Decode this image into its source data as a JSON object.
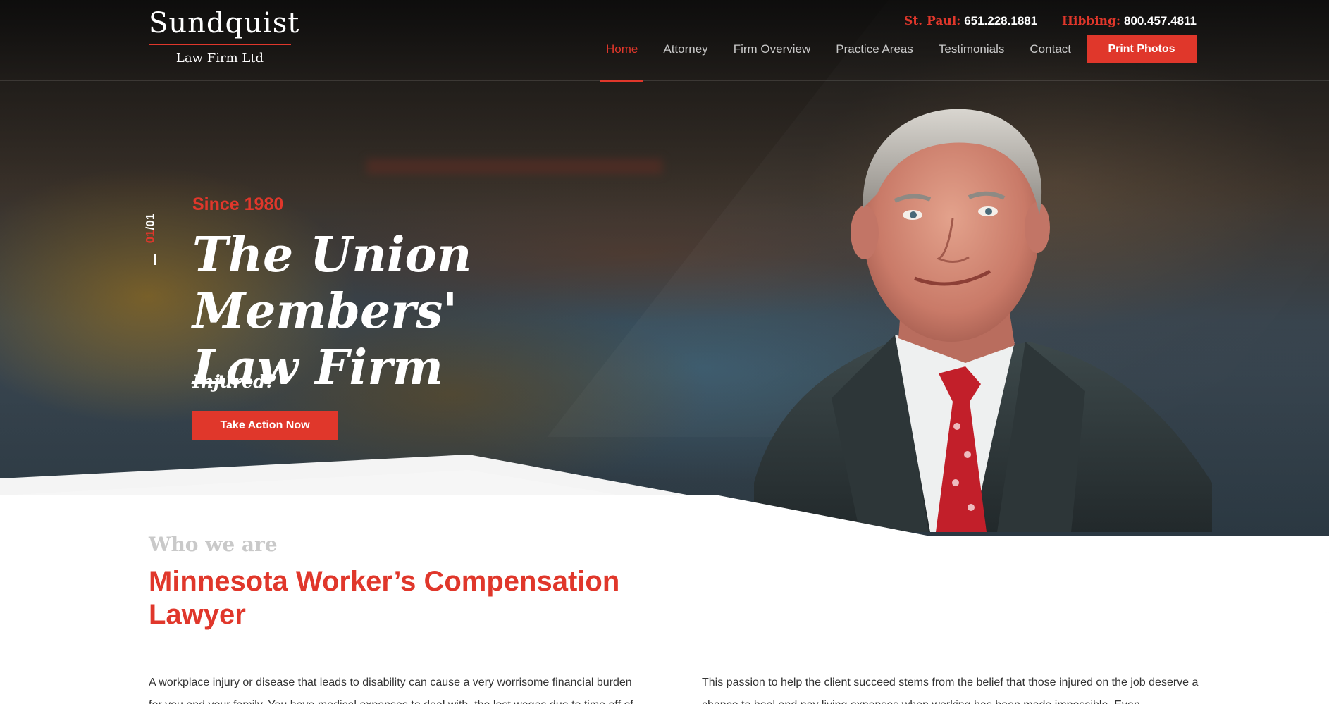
{
  "brand": {
    "name": "Sundquist",
    "subtitle": "Law Firm Ltd"
  },
  "phones": [
    {
      "label": "St. Paul:",
      "number": "651.228.1881"
    },
    {
      "label": "Hibbing:",
      "number": "800.457.4811"
    }
  ],
  "nav": {
    "items": [
      {
        "label": "Home",
        "active": true
      },
      {
        "label": "Attorney"
      },
      {
        "label": "Firm Overview"
      },
      {
        "label": "Practice Areas"
      },
      {
        "label": "Testimonials"
      },
      {
        "label": "Contact"
      }
    ],
    "cta_label": "Print Photos"
  },
  "slider": {
    "current": "01",
    "separator": "/",
    "total": "01"
  },
  "hero": {
    "kicker": "Since 1980",
    "title_line1": "The Union Members'",
    "title_line2": "Law Firm",
    "subtitle": "Injured?",
    "button_label": "Take Action Now"
  },
  "about": {
    "eyebrow": "Who we are",
    "title_line1": "Minnesota Worker’s Compensation",
    "title_line2": "Lawyer",
    "para_left": "A workplace injury or disease that leads to disability can cause a very worrisome financial burden for you and your family. You have medical expenses to deal with, the lost wages due to time off of",
    "para_right": "This passion to help the client succeed stems from the belief that those injured on the job deserve a chance to heal and pay living expenses when working has been made impossible. Even"
  },
  "colors": {
    "accent": "#e0372b",
    "nav_text": "#c9c9c9",
    "eyebrow": "#c9c9c9",
    "body_text": "#333333"
  }
}
